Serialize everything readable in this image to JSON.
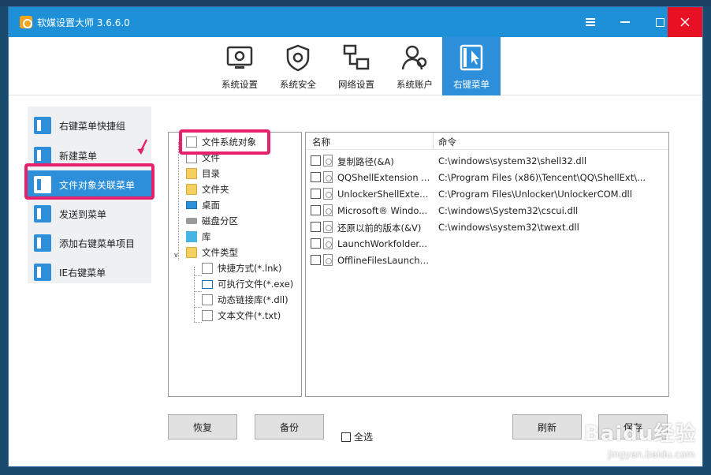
{
  "window": {
    "title": "软媒设置大师 3.6.6.0",
    "accent": "#2d8fd9",
    "highlight": "#e6206b"
  },
  "toolbar": {
    "items": [
      {
        "label": "系统设置",
        "icon": "monitor-gear-icon"
      },
      {
        "label": "系统安全",
        "icon": "shield-gear-icon"
      },
      {
        "label": "网络设置",
        "icon": "network-icon"
      },
      {
        "label": "系统账户",
        "icon": "users-icon"
      },
      {
        "label": "右键菜单",
        "icon": "cursor-menu-icon",
        "active": true
      }
    ]
  },
  "sidebar": {
    "items": [
      {
        "label": "右键菜单快捷组"
      },
      {
        "label": "新建菜单"
      },
      {
        "label": "文件对象关联菜单",
        "active": true
      },
      {
        "label": "发送到菜单"
      },
      {
        "label": "添加右键菜单项目"
      },
      {
        "label": "IE右键菜单"
      }
    ]
  },
  "tree": {
    "root": "文件系统对象",
    "items": [
      {
        "label": "文件",
        "icon": "doc-icon"
      },
      {
        "label": "目录",
        "icon": "folder-icon"
      },
      {
        "label": "文件夹",
        "icon": "folder-icon"
      },
      {
        "label": "桌面",
        "icon": "desktop-icon"
      },
      {
        "label": "磁盘分区",
        "icon": "disk-icon"
      },
      {
        "label": "库",
        "icon": "library-icon"
      },
      {
        "label": "文件类型",
        "icon": "folder-icon",
        "expanded": true
      }
    ],
    "children": [
      {
        "label": "快捷方式(*.lnk)",
        "icon": "shortcut-icon"
      },
      {
        "label": "可执行文件(*.exe)",
        "icon": "exe-icon"
      },
      {
        "label": "动态链接库(*.dll)",
        "icon": "dll-icon"
      },
      {
        "label": "文本文件(*.txt)",
        "icon": "txt-icon"
      }
    ]
  },
  "list": {
    "col_name": "名称",
    "col_command": "命令",
    "rows": [
      {
        "name": "复制路径(&A)",
        "command": "C:\\windows\\system32\\shell32.dll"
      },
      {
        "name": "QQShellExtension ...",
        "command": "C:\\Program Files (x86)\\Tencent\\QQ\\ShellExt\\..."
      },
      {
        "name": "UnlockerShellExten...",
        "command": "C:\\Program Files\\Unlocker\\UnlockerCOM.dll"
      },
      {
        "name": "Microsoft® Windo...",
        "command": "C:\\windows\\System32\\cscui.dll"
      },
      {
        "name": "还原以前的版本(&V)",
        "command": "C:\\windows\\system32\\twext.dll"
      },
      {
        "name": "LaunchWorkfolder...",
        "command": ""
      },
      {
        "name": "OfflineFilesLaunchS...",
        "command": ""
      }
    ]
  },
  "buttons": {
    "restore": "恢复",
    "backup": "备份",
    "select_all": "全选",
    "refresh": "刷新",
    "save": "保存"
  },
  "watermark": {
    "logo": "Baidu经验",
    "url": "jingyan.baidu.com"
  }
}
